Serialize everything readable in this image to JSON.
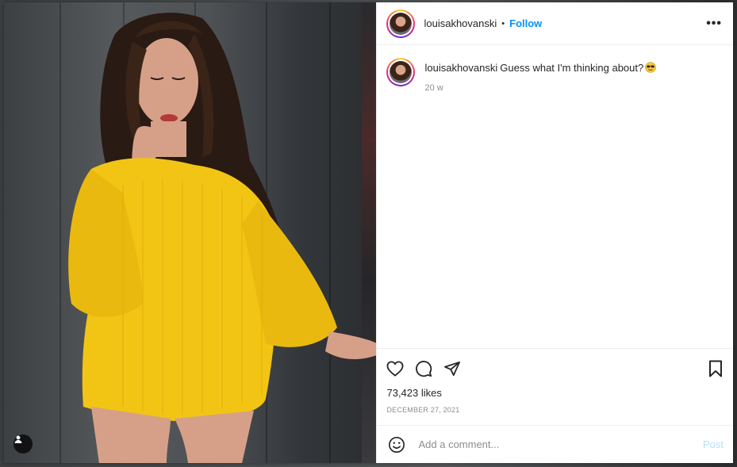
{
  "post": {
    "username": "louisakhovanski",
    "separator": "•",
    "follow_label": "Follow",
    "more_icon": "more-horizontal-icon",
    "more_label": "•••"
  },
  "caption": {
    "username": "louisakhovanski",
    "text": "Guess what I'm thinking about?",
    "emoji": "smiling-face-with-sunglasses-emoji",
    "time_ago": "20 w"
  },
  "actions": {
    "icons": [
      "heart-icon",
      "comment-icon",
      "share-icon",
      "bookmark-icon"
    ],
    "likes": "73,423 likes",
    "date": "DECEMBER 27, 2021"
  },
  "comment_box": {
    "placeholder": "Add a comment...",
    "post_label": "Post",
    "emoji_icon": "smiley-icon"
  },
  "photo": {
    "description_icon": "user-tag-icon"
  },
  "colors": {
    "follow_blue": "#0095f6",
    "post_disabled": "#b2dffc",
    "muted_text": "#8e8e8e",
    "sweater_yellow": "#f2c515"
  }
}
